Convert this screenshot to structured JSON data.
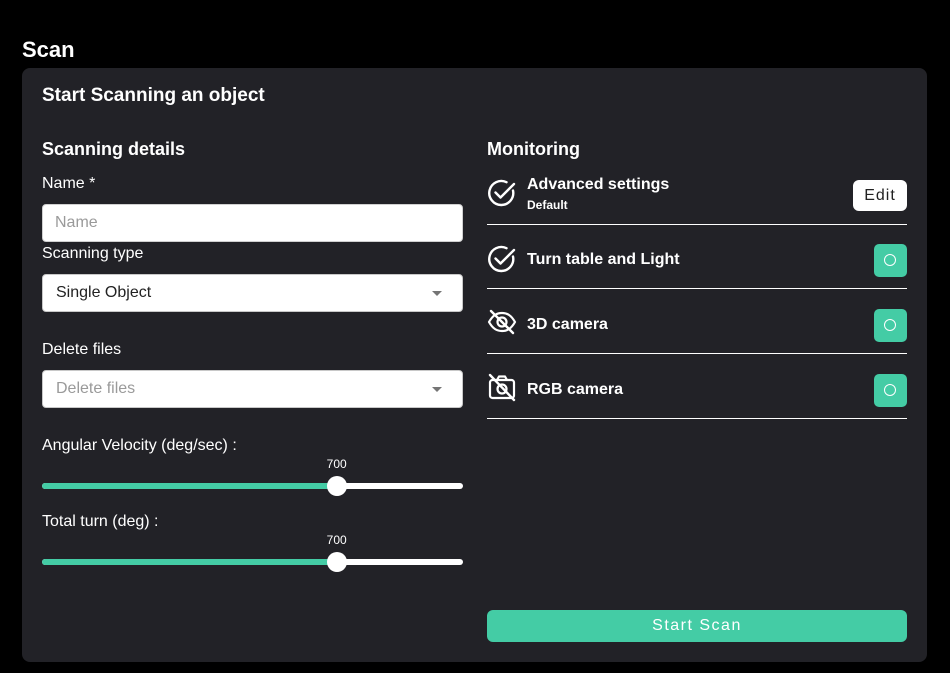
{
  "page": {
    "title": "Scan"
  },
  "card": {
    "title": "Start Scanning an object",
    "details": {
      "title": "Scanning details",
      "name": {
        "label": "Name *",
        "value": "",
        "placeholder": "Name"
      },
      "scanning_type": {
        "label": "Scanning type",
        "selected": "Single Object"
      },
      "delete_files": {
        "label": "Delete files",
        "placeholder": "Delete files"
      },
      "angular_velocity": {
        "label": "Angular Velocity (deg/sec) :",
        "value": "700",
        "fraction": 0.7
      },
      "total_turn": {
        "label": "Total turn (deg) :",
        "value": "700",
        "fraction": 0.7
      }
    },
    "monitoring": {
      "title": "Monitoring",
      "advanced": {
        "name": "Advanced settings",
        "sub": "Default",
        "edit_label": "Edit",
        "icon": "check-circle-icon"
      },
      "turntable": {
        "name": "Turn table and Light",
        "icon": "check-circle-icon",
        "status": "on"
      },
      "camera3d": {
        "name": "3D camera",
        "icon": "eye-off-icon",
        "status": "on"
      },
      "rgb_camera": {
        "name": "RGB camera",
        "icon": "camera-off-icon",
        "status": "on"
      }
    },
    "start_label": "Start Scan"
  },
  "colors": {
    "accent": "#44cca5",
    "card": "#222227",
    "background": "#000000"
  }
}
